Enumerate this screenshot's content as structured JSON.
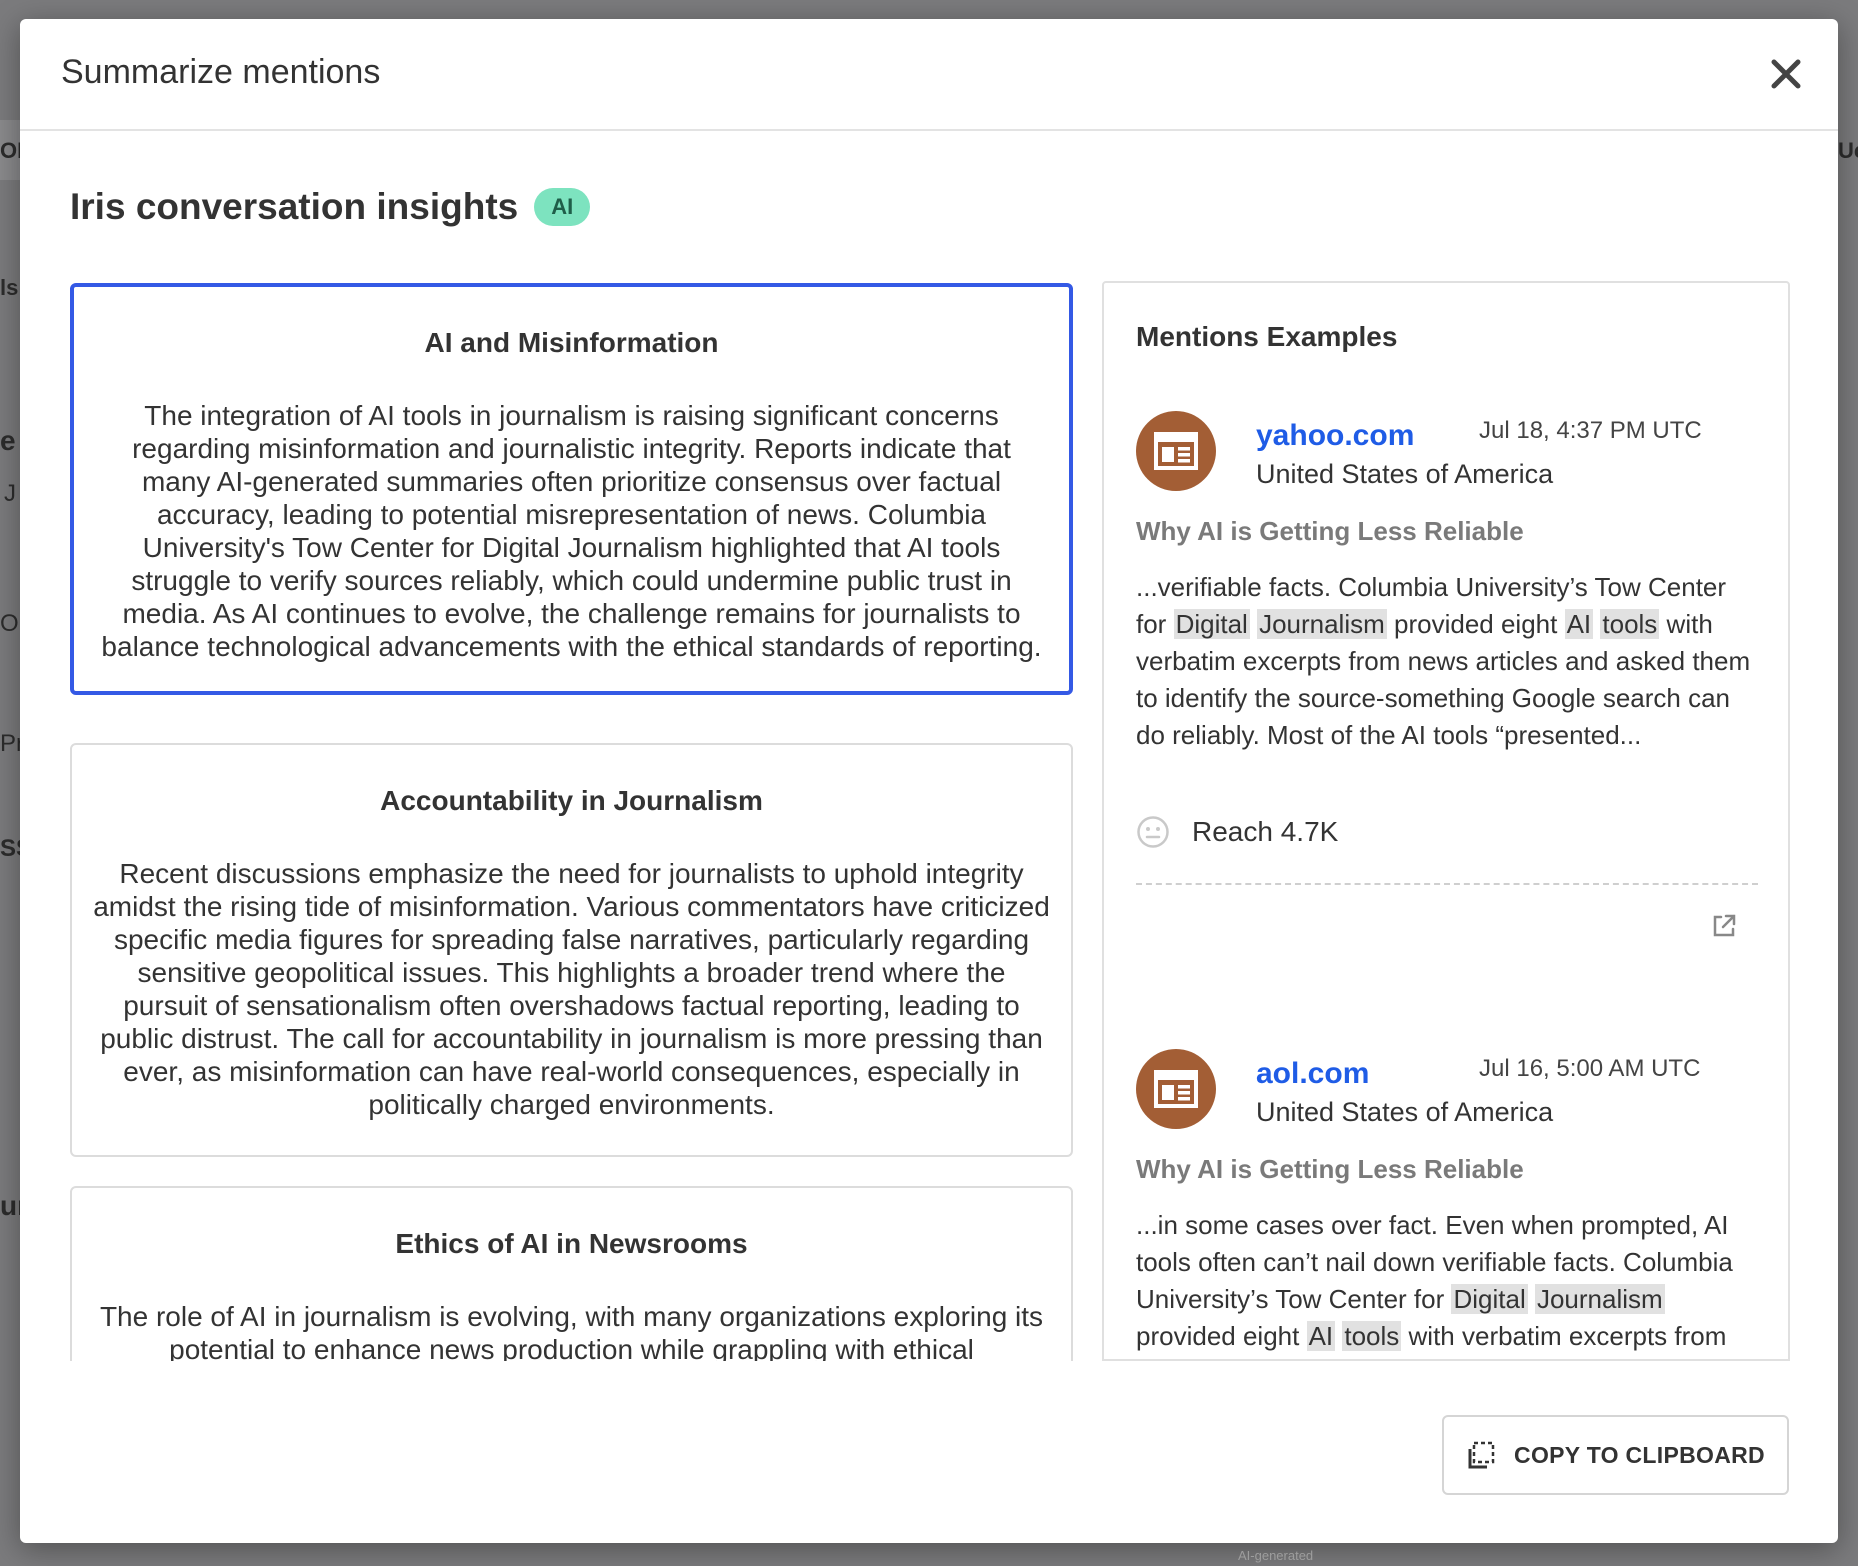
{
  "dialog": {
    "title": "Summarize mentions"
  },
  "insights": {
    "title": "Iris conversation insights",
    "badge": "AI"
  },
  "topics": [
    {
      "title": "AI and Misinformation",
      "body": "The integration of AI tools in journalism is raising significant concerns regarding misinformation and journalistic integrity. Reports indicate that many AI-generated summaries often prioritize consensus over factual accuracy, leading to potential misrepresentation of news. Columbia University's Tow Center for Digital Journalism highlighted that AI tools struggle to verify sources reliably, which could undermine public trust in media. As AI continues to evolve, the challenge remains for journalists to balance technological advancements with the ethical standards of reporting."
    },
    {
      "title": "Accountability in Journalism",
      "body": "Recent discussions emphasize the need for journalists to uphold integrity amidst the rising tide of misinformation. Various commentators have criticized specific media figures for spreading false narratives, particularly regarding sensitive geopolitical issues. This highlights a broader trend where the pursuit of sensationalism often overshadows factual reporting, leading to public distrust. The call for accountability in journalism is more pressing than ever, as misinformation can have real-world consequences, especially in politically charged environments."
    },
    {
      "title": "Ethics of AI in Newsrooms",
      "body": "The role of AI in journalism is evolving, with many organizations exploring its potential to enhance news production while grappling with ethical"
    }
  ],
  "mentions": {
    "title": "Mentions Examples",
    "items": [
      {
        "source": "yahoo.com",
        "time": "Jul 18, 4:37 PM UTC",
        "country": "United States of America",
        "headline": "Why AI is Getting Less Reliable",
        "excerpt_parts": [
          {
            "t": "...verifiable facts. Columbia University’s Tow Center for "
          },
          {
            "t": "Digital",
            "hl": true
          },
          {
            "t": " "
          },
          {
            "t": "Journalism",
            "hl": true
          },
          {
            "t": " provided eight "
          },
          {
            "t": "AI",
            "hl": true
          },
          {
            "t": " "
          },
          {
            "t": "tools",
            "hl": true
          },
          {
            "t": " with verbatim excerpts from news articles and asked them to identify the source-something Google search can do reliably. Most of the AI tools “presented..."
          }
        ],
        "reach_label": "Reach 4.7K"
      },
      {
        "source": "aol.com",
        "time": "Jul 16, 5:00 AM UTC",
        "country": "United States of America",
        "headline": "Why AI is Getting Less Reliable",
        "excerpt_parts": [
          {
            "t": "...in some cases over fact. Even when prompted, AI tools often can’t nail down verifiable facts. Columbia University’s Tow Center for "
          },
          {
            "t": "Digital",
            "hl": true
          },
          {
            "t": " "
          },
          {
            "t": "Journalism",
            "hl": true
          },
          {
            "t": " provided eight "
          },
          {
            "t": "AI",
            "hl": true
          },
          {
            "t": " "
          },
          {
            "t": "tools",
            "hl": true
          },
          {
            "t": " with verbatim excerpts from"
          }
        ],
        "reach_label": ""
      }
    ]
  },
  "actions": {
    "copy_label": "COPY TO CLIPBOARD"
  },
  "footer": {
    "ai_generated": "AI-generated"
  },
  "background": {
    "fragments": [
      "OD",
      "Uc",
      "ls",
      "e",
      "J",
      "O",
      "Pr",
      "SS",
      "ur"
    ]
  },
  "colors": {
    "accent_blue": "#3459e5",
    "link_blue": "#1f5ce6",
    "badge_green": "#7de3bf",
    "avatar_brown": "#a35e35",
    "highlight_gray": "#e1e1e1"
  },
  "icons": {
    "close": "close-icon",
    "avatar": "news-article-icon",
    "sentiment": "neutral-face-icon",
    "external": "external-link-icon",
    "copy": "copy-icon"
  }
}
